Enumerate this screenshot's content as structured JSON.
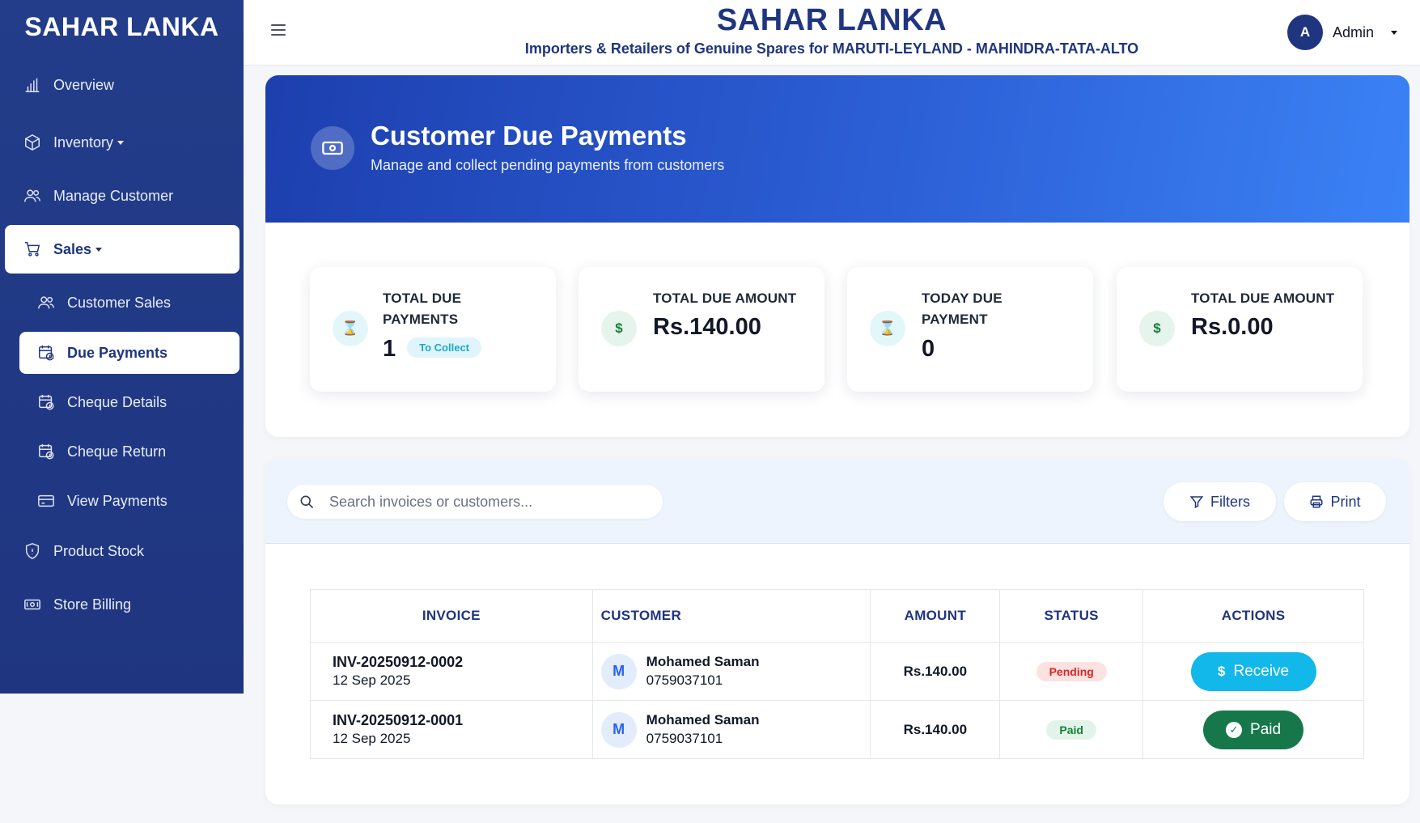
{
  "brand": "SAHAR LANKA",
  "sidebar": {
    "items": [
      {
        "label": "Overview",
        "icon": "bar-chart-icon"
      },
      {
        "label": "Inventory",
        "icon": "box-icon"
      },
      {
        "label": "Manage Customer",
        "icon": "users-icon"
      },
      {
        "label": "Sales",
        "icon": "cart-icon"
      },
      {
        "label": "Product Stock",
        "icon": "shield-icon"
      },
      {
        "label": "Store Billing",
        "icon": "cash-icon"
      }
    ],
    "sales_sub": [
      {
        "label": "Customer Sales",
        "icon": "users-icon"
      },
      {
        "label": "Due Payments",
        "icon": "calendar-money-icon"
      },
      {
        "label": "Cheque Details",
        "icon": "calendar-money-icon"
      },
      {
        "label": "Cheque Return",
        "icon": "calendar-money-icon"
      },
      {
        "label": "View Payments",
        "icon": "card-icon"
      }
    ]
  },
  "header": {
    "title": "SAHAR LANKA",
    "subtitle": "Importers & Retailers of Genuine Spares for MARUTI-LEYLAND - MAHINDRA-TATA-ALTO",
    "user_initial": "A",
    "user_name": "Admin"
  },
  "hero": {
    "title": "Customer Due Payments",
    "subtitle": "Manage and collect pending payments from customers"
  },
  "stats": [
    {
      "label_line1": "TOTAL DUE",
      "label_line2": "PAYMENTS",
      "value": "1",
      "badge": "To Collect",
      "icon": "hourglass-icon",
      "icon_glyph": "⌛"
    },
    {
      "label": "TOTAL DUE AMOUNT",
      "value": "Rs.140.00",
      "icon": "dollar-icon",
      "icon_glyph": "$"
    },
    {
      "label_line1": "TODAY DUE",
      "label_line2": "PAYMENT",
      "value": "0",
      "icon": "hourglass-icon",
      "icon_glyph": "⌛"
    },
    {
      "label": "TOTAL DUE AMOUNT",
      "value": "Rs.0.00",
      "icon": "dollar-icon",
      "icon_glyph": "$"
    }
  ],
  "toolbar": {
    "search_placeholder": "Search invoices or customers...",
    "filters_label": "Filters",
    "print_label": "Print"
  },
  "table": {
    "headers": [
      "INVOICE",
      "CUSTOMER",
      "AMOUNT",
      "STATUS",
      "ACTIONS"
    ],
    "rows": [
      {
        "invoice": "INV-20250912-0002",
        "date": "12 Sep 2025",
        "initial": "M",
        "customer": "Mohamed Saman",
        "phone": "0759037101",
        "amount": "Rs.140.00",
        "status": "Pending",
        "action": "Receive",
        "action_glyph": "$"
      },
      {
        "invoice": "INV-20250912-0001",
        "date": "12 Sep 2025",
        "initial": "M",
        "customer": "Mohamed Saman",
        "phone": "0759037101",
        "amount": "Rs.140.00",
        "status": "Paid",
        "action": "Paid",
        "action_glyph": "✓"
      }
    ]
  },
  "colors": {
    "sidebar": "#1f3580",
    "accent": "#2563eb",
    "receive": "#12b8e9",
    "paid": "#16784a",
    "pending_text": "#dc2626"
  }
}
